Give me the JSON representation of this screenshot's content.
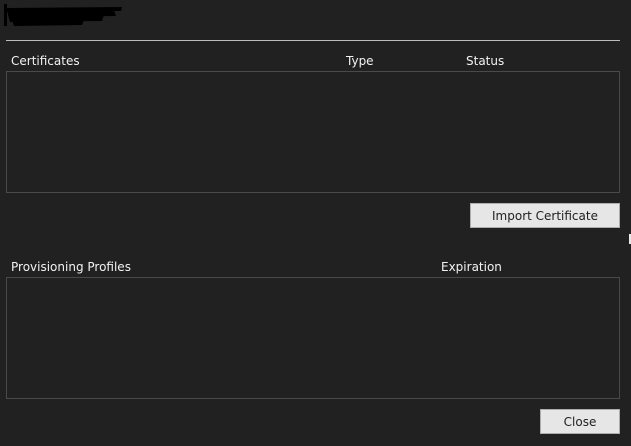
{
  "window": {
    "title_redacted": true
  },
  "certificates": {
    "columns": [
      "Certificates",
      "Type",
      "Status"
    ],
    "rows": [],
    "import_button_label": "Import Certificate"
  },
  "provisioning_profiles": {
    "columns": [
      "Provisioning Profiles",
      "Expiration"
    ],
    "rows": []
  },
  "footer": {
    "close_button_label": "Close"
  },
  "colors": {
    "background": "#212121",
    "list_border": "#4a4a4a",
    "button_face": "#e6e6e6",
    "button_border": "#adadad",
    "divider": "#bdbdbd"
  }
}
